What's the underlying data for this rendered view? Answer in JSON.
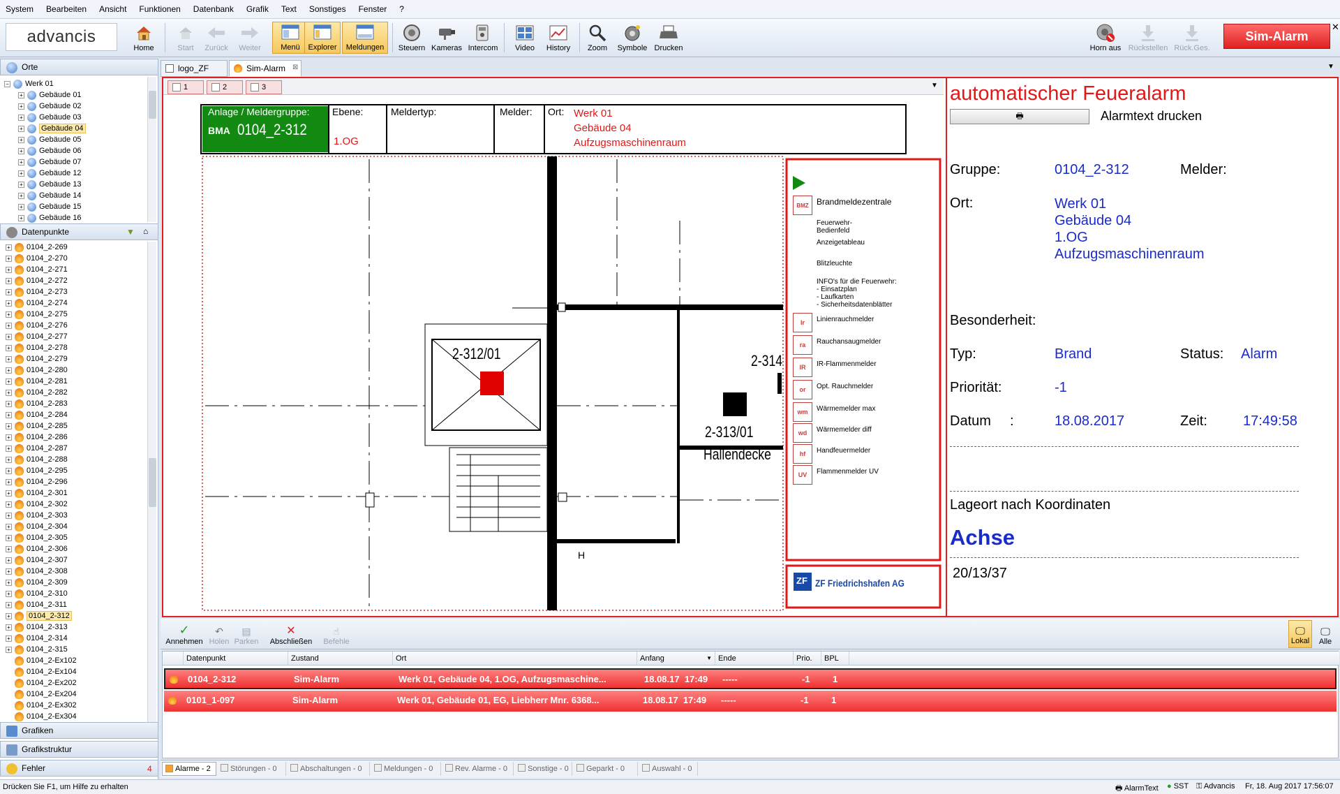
{
  "menu": [
    "System",
    "Bearbeiten",
    "Ansicht",
    "Funktionen",
    "Datenbank",
    "Grafik",
    "Text",
    "Sonstiges",
    "Fenster",
    "?"
  ],
  "logo": "advancis",
  "toolbar": {
    "home": "Home",
    "start": "Start",
    "back": "Zurück",
    "forward": "Weiter",
    "menu": "Menü",
    "explorer": "Explorer",
    "messages": "Meldungen",
    "control": "Steuern",
    "cameras": "Kameras",
    "intercom": "Intercom",
    "video": "Video",
    "history": "History",
    "zoom": "Zoom",
    "symbols": "Symbole",
    "print": "Drucken",
    "horn_off": "Horn aus",
    "reset": "Rückstellen",
    "reset_all": "Rück.Ges.",
    "sim_alarm": "Sim-Alarm"
  },
  "locations": {
    "header": "Orte",
    "root": "Werk 01",
    "items": [
      "Gebäude 01",
      "Gebäude 02",
      "Gebäude 03",
      "Gebäude 04",
      "Gebäude 05",
      "Gebäude 06",
      "Gebäude 07",
      "Gebäude 12",
      "Gebäude 13",
      "Gebäude 14",
      "Gebäude 15",
      "Gebäude 16"
    ],
    "selected": "Gebäude 04"
  },
  "datapoints": {
    "header": "Datenpunkte",
    "items": [
      "0104_2-269",
      "0104_2-270",
      "0104_2-271",
      "0104_2-272",
      "0104_2-273",
      "0104_2-274",
      "0104_2-275",
      "0104_2-276",
      "0104_2-277",
      "0104_2-278",
      "0104_2-279",
      "0104_2-280",
      "0104_2-281",
      "0104_2-282",
      "0104_2-283",
      "0104_2-284",
      "0104_2-285",
      "0104_2-286",
      "0104_2-287",
      "0104_2-288",
      "0104_2-295",
      "0104_2-296",
      "0104_2-301",
      "0104_2-302",
      "0104_2-303",
      "0104_2-304",
      "0104_2-305",
      "0104_2-306",
      "0104_2-307",
      "0104_2-308",
      "0104_2-309",
      "0104_2-310",
      "0104_2-311",
      "0104_2-312",
      "0104_2-313",
      "0104_2-314",
      "0104_2-315",
      "0104_2-Ex102",
      "0104_2-Ex104",
      "0104_2-Ex202",
      "0104_2-Ex204",
      "0104_2-Ex302",
      "0104_2-Ex304"
    ],
    "selected": "0104_2-312"
  },
  "left_sections": {
    "graphics": "Grafiken",
    "graphics_structure": "Grafikstruktur",
    "errors": "Fehler",
    "errors_count": "4"
  },
  "doc_tabs": [
    "logo_ZF",
    "Sim-Alarm"
  ],
  "sub_tabs": [
    "1",
    "2",
    "3"
  ],
  "plan": {
    "group_label": "Anlage / Meldergruppe:",
    "system": "BMA",
    "group": "0104_2-312",
    "level_label": "Ebene:",
    "level": "1.OG",
    "type_label": "Meldertyp:",
    "detector_label": "Melder:",
    "location_label": "Ort:",
    "location_lines": [
      "Werk 01",
      "Gebäude 04",
      "Aufzugsmaschinenraum"
    ],
    "room1": "2-312/01",
    "room2": "2-313/01",
    "room3": "2-314",
    "room2_sub": "Hallendecke",
    "mark_h": "H",
    "legend": [
      {
        "icon": "BMZ",
        "label": "Brandmeldezentrale"
      },
      {
        "icon": "",
        "label": "Feuerwehr-\nBedienfeld"
      },
      {
        "icon": "",
        "label": "Anzeigetableau"
      },
      {
        "icon": "",
        "label": "Blitzleuchte"
      },
      {
        "icon": "",
        "label": "INFO's für die Feuerwehr:\n- Einsatzplan\n- Laufkarten\n- Sicherheitsdatenblätter"
      },
      {
        "icon": "lr",
        "label": "Linienrauchmelder"
      },
      {
        "icon": "ra",
        "label": "Rauchansaugmelder"
      },
      {
        "icon": "IR",
        "label": "IR-Flammenmelder"
      },
      {
        "icon": "or",
        "label": "Opt. Rauchmelder"
      },
      {
        "icon": "wm",
        "label": "Wärmemelder max"
      },
      {
        "icon": "wd",
        "label": "Wärmemelder diff"
      },
      {
        "icon": "hf",
        "label": "Handfeuermelder"
      },
      {
        "icon": "UV",
        "label": "Flammenmelder UV"
      }
    ],
    "company_logo": "ZF",
    "company": "ZF Friedrichshafen AG"
  },
  "info": {
    "title": "automatischer Feueralarm",
    "print_label": "Alarmtext drucken",
    "group_label": "Gruppe:",
    "group": "0104_2-312",
    "detector_label": "Melder:",
    "location_label": "Ort:",
    "location": [
      "Werk 01",
      "Gebäude 04",
      "1.OG",
      "Aufzugsmaschinenraum"
    ],
    "special_label": "Besonderheit:",
    "type_label": "Typ:",
    "type": "Brand",
    "status_label": "Status:",
    "status": "Alarm",
    "priority_label": "Priorität:",
    "priority": "-1",
    "date_label": "Datum",
    "date_colon": ":",
    "date": "18.08.2017",
    "time_label": "Zeit:",
    "time": "17:49:58",
    "coord_label": "Lageort nach Koordinaten",
    "axis": "Achse",
    "coord": "20/13/37"
  },
  "alarm_actions": {
    "accept": "Annehmen",
    "fetch": "Holen",
    "park": "Parken",
    "close": "Abschließen",
    "commands": "Befehle",
    "local": "Lokal",
    "all": "Alle"
  },
  "alarm_list": {
    "columns": [
      "Datenpunkt",
      "Zustand",
      "Ort",
      "Anfang",
      "Ende",
      "Prio.",
      "BPL"
    ],
    "rows": [
      {
        "dp": "0104_2-312",
        "state": "Sim-Alarm",
        "loc": "Werk 01, Gebäude 04, 1.OG, Aufzugsmaschine...",
        "start": "18.08.17  17:49",
        "end": "-----",
        "prio": "-1",
        "bpl": "1"
      },
      {
        "dp": "0101_1-097",
        "state": "Sim-Alarm",
        "loc": "Werk 01, Gebäude 01, EG, Liebherr Mnr. 6368...",
        "start": "18.08.17  17:49",
        "end": "-----",
        "prio": "-1",
        "bpl": "1"
      }
    ]
  },
  "bottom_tabs": [
    "Alarme - 2",
    "Störungen - 0",
    "Abschaltungen - 0",
    "Meldungen - 0",
    "Rev. Alarme - 0",
    "Sonstige - 0",
    "Geparkt - 0",
    "Auswahl - 0"
  ],
  "status": {
    "help": "Drücken Sie F1, um Hilfe zu erhalten",
    "alarmtext": "AlarmText",
    "sst": "SST",
    "user": "Advancis",
    "datetime": "Fr, 18. Aug 2017  17:56:07"
  }
}
